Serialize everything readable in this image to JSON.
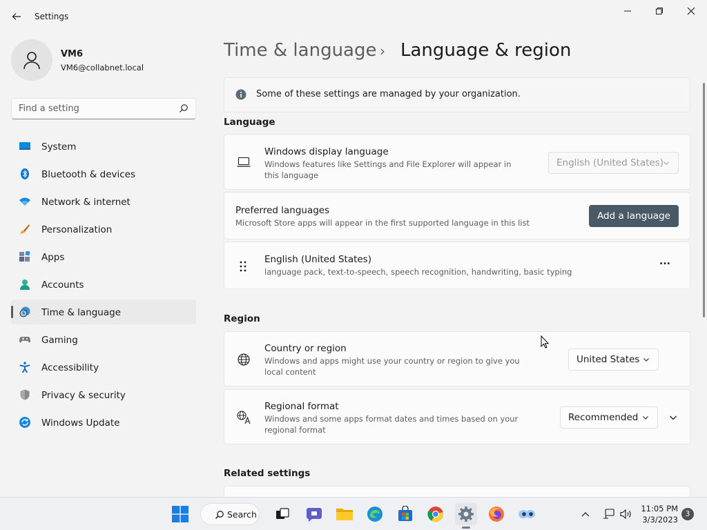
{
  "window": {
    "app_title": "Settings"
  },
  "profile": {
    "name": "VM6",
    "email": "VM6@collabnet.local"
  },
  "search": {
    "placeholder": "Find a setting"
  },
  "sidebar": {
    "items": [
      {
        "label": "System",
        "icon": "system-icon",
        "color": "#0078d4"
      },
      {
        "label": "Bluetooth & devices",
        "icon": "bluetooth-icon",
        "color": "#0078d4"
      },
      {
        "label": "Network & internet",
        "icon": "wifi-icon",
        "color": "#0078d4"
      },
      {
        "label": "Personalization",
        "icon": "brush-icon",
        "color": "#e07a2b"
      },
      {
        "label": "Apps",
        "icon": "apps-icon",
        "color": "#5c6b7a"
      },
      {
        "label": "Accounts",
        "icon": "accounts-icon",
        "color": "#2aa198"
      },
      {
        "label": "Time & language",
        "icon": "time-language-icon",
        "color": "#0078d4",
        "active": true
      },
      {
        "label": "Gaming",
        "icon": "gaming-icon",
        "color": "#707070"
      },
      {
        "label": "Accessibility",
        "icon": "accessibility-icon",
        "color": "#0067c0"
      },
      {
        "label": "Privacy & security",
        "icon": "shield-icon",
        "color": "#707070"
      },
      {
        "label": "Windows Update",
        "icon": "update-icon",
        "color": "#0078d4"
      }
    ]
  },
  "breadcrumb": {
    "parent": "Time & language",
    "separator": "›",
    "current": "Language & region"
  },
  "notice": {
    "text": "Some of these settings are managed by your organization."
  },
  "language": {
    "heading": "Language",
    "display_language": {
      "title": "Windows display language",
      "desc": "Windows features like Settings and File Explorer will appear in this language",
      "value": "English (United States)"
    },
    "preferred": {
      "title": "Preferred languages",
      "desc": "Microsoft Store apps will appear in the first supported language in this list",
      "button": "Add a language"
    },
    "installed": {
      "title": "English (United States)",
      "desc": "language pack, text-to-speech, speech recognition, handwriting, basic typing",
      "more": "..."
    }
  },
  "region": {
    "heading": "Region",
    "country": {
      "title": "Country or region",
      "desc": "Windows and apps might use your country or region to give you local content",
      "value": "United States"
    },
    "format": {
      "title": "Regional format",
      "desc": "Windows and some apps format dates and times based on your regional format",
      "value": "Recommended"
    }
  },
  "related": {
    "heading": "Related settings"
  },
  "taskbar": {
    "search_label": "Search",
    "time": "11:05 PM",
    "date": "3/3/2023",
    "notifications": "3"
  }
}
